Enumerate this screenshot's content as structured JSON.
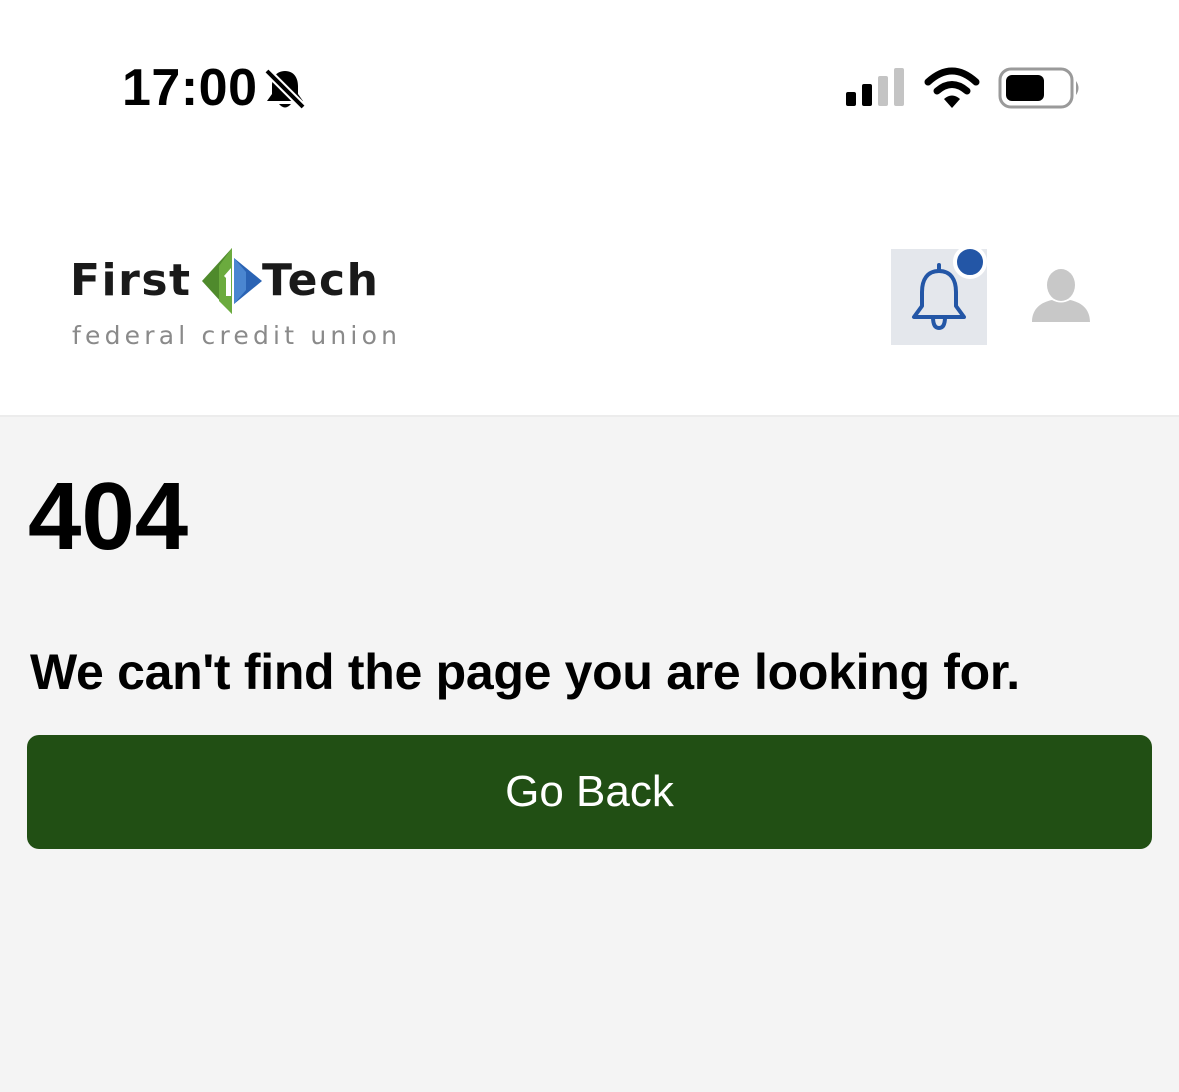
{
  "status_bar": {
    "time": "17:00",
    "icons": [
      "bell-slash-icon",
      "cellular-signal-icon",
      "wifi-icon",
      "battery-icon"
    ]
  },
  "header": {
    "logo": {
      "word_first": "First",
      "word_tech": "Tech",
      "tagline": "federal credit union"
    },
    "icons": [
      "bell-icon",
      "user-icon"
    ],
    "has_unread_notifications": true
  },
  "error": {
    "code": "404",
    "message": "We can't find the page you are looking for."
  },
  "actions": {
    "go_back_label": "Go Back"
  },
  "colors": {
    "primary": "#214f14",
    "notification_dot": "#2356a6",
    "page_background": "#f4f4f4"
  }
}
